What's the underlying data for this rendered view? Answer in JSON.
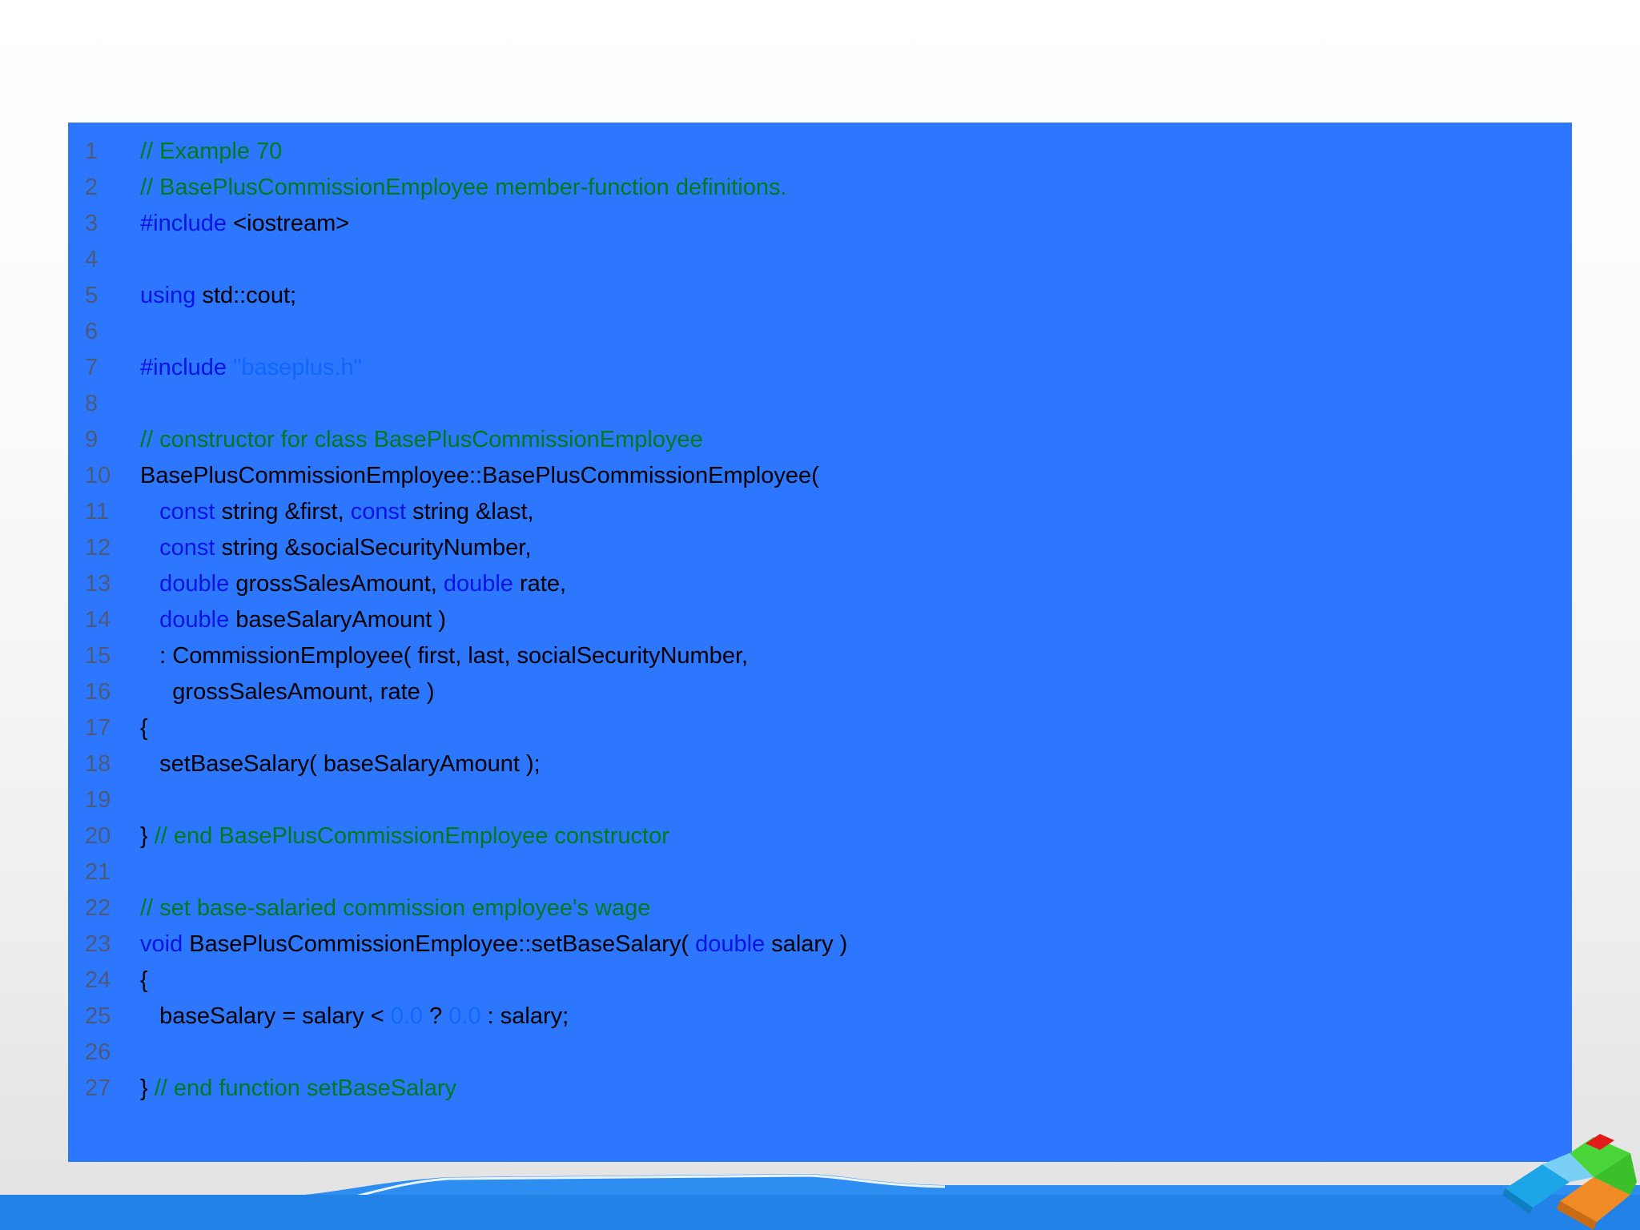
{
  "code": {
    "lines": [
      {
        "n": "1",
        "tokens": [
          {
            "t": "// Example 70",
            "k": "comment"
          }
        ]
      },
      {
        "n": "2",
        "tokens": [
          {
            "t": "// BasePlusCommissionEmployee member-function definitions.",
            "k": "comment"
          }
        ]
      },
      {
        "n": "3",
        "tokens": [
          {
            "t": "#include",
            "k": "keyword"
          },
          {
            "t": " <iostream>",
            "k": "plain"
          }
        ]
      },
      {
        "n": "4",
        "tokens": []
      },
      {
        "n": "5",
        "tokens": [
          {
            "t": "using",
            "k": "keyword"
          },
          {
            "t": " std::cout;",
            "k": "plain"
          }
        ]
      },
      {
        "n": "6",
        "tokens": []
      },
      {
        "n": "7",
        "tokens": [
          {
            "t": "#include",
            "k": "keyword"
          },
          {
            "t": " ",
            "k": "plain"
          },
          {
            "t": "\"baseplus.h\"",
            "k": "string"
          }
        ]
      },
      {
        "n": "8",
        "tokens": []
      },
      {
        "n": "9",
        "tokens": [
          {
            "t": "// constructor for class BasePlusCommissionEmployee",
            "k": "comment"
          }
        ]
      },
      {
        "n": "10",
        "tokens": [
          {
            "t": "BasePlusCommissionEmployee::BasePlusCommissionEmployee(",
            "k": "plain"
          }
        ]
      },
      {
        "n": "11",
        "tokens": [
          {
            "t": "   ",
            "k": "plain"
          },
          {
            "t": "const",
            "k": "keyword"
          },
          {
            "t": " string &first, ",
            "k": "plain"
          },
          {
            "t": "const",
            "k": "keyword"
          },
          {
            "t": " string &last,",
            "k": "plain"
          }
        ]
      },
      {
        "n": "12",
        "tokens": [
          {
            "t": "   ",
            "k": "plain"
          },
          {
            "t": "const",
            "k": "keyword"
          },
          {
            "t": " string &socialSecurityNumber,",
            "k": "plain"
          }
        ]
      },
      {
        "n": "13",
        "tokens": [
          {
            "t": "   ",
            "k": "plain"
          },
          {
            "t": "double",
            "k": "keyword"
          },
          {
            "t": " grossSalesAmount, ",
            "k": "plain"
          },
          {
            "t": "double",
            "k": "keyword"
          },
          {
            "t": " rate,",
            "k": "plain"
          }
        ]
      },
      {
        "n": "14",
        "tokens": [
          {
            "t": "   ",
            "k": "plain"
          },
          {
            "t": "double",
            "k": "keyword"
          },
          {
            "t": " baseSalaryAmount )",
            "k": "plain"
          }
        ]
      },
      {
        "n": "15",
        "tokens": [
          {
            "t": "   : CommissionEmployee( first, last, socialSecurityNumber,",
            "k": "plain"
          }
        ]
      },
      {
        "n": "16",
        "tokens": [
          {
            "t": "     grossSalesAmount, rate )",
            "k": "plain"
          }
        ]
      },
      {
        "n": "17",
        "tokens": [
          {
            "t": "{",
            "k": "plain"
          }
        ]
      },
      {
        "n": "18",
        "tokens": [
          {
            "t": "   setBaseSalary( baseSalaryAmount );",
            "k": "plain"
          }
        ]
      },
      {
        "n": "19",
        "tokens": []
      },
      {
        "n": "20",
        "tokens": [
          {
            "t": "} ",
            "k": "plain"
          },
          {
            "t": "// end BasePlusCommissionEmployee constructor",
            "k": "comment"
          }
        ]
      },
      {
        "n": "21",
        "tokens": []
      },
      {
        "n": "22",
        "tokens": [
          {
            "t": "// set base-salaried commission employee's wage",
            "k": "comment"
          }
        ]
      },
      {
        "n": "23",
        "tokens": [
          {
            "t": "void",
            "k": "keyword"
          },
          {
            "t": " BasePlusCommissionEmployee::setBaseSalary( ",
            "k": "plain"
          },
          {
            "t": "double",
            "k": "keyword"
          },
          {
            "t": " salary )",
            "k": "plain"
          }
        ]
      },
      {
        "n": "24",
        "tokens": [
          {
            "t": "{",
            "k": "plain"
          }
        ]
      },
      {
        "n": "25",
        "tokens": [
          {
            "t": "   baseSalary = salary < ",
            "k": "plain"
          },
          {
            "t": "0.0",
            "k": "number"
          },
          {
            "t": " ? ",
            "k": "plain"
          },
          {
            "t": "0.0",
            "k": "number"
          },
          {
            "t": " : salary;",
            "k": "plain"
          }
        ]
      },
      {
        "n": "26",
        "tokens": []
      },
      {
        "n": "27",
        "tokens": [
          {
            "t": "} ",
            "k": "plain"
          },
          {
            "t": "// end function setBaseSalary",
            "k": "comment"
          }
        ]
      }
    ]
  },
  "colors": {
    "panel_background": "#2c77fe",
    "comment": "#007a1e",
    "keyword": "#0b12e6",
    "string_literal": "#1166ff",
    "line_number": "#4b5a7a",
    "footer_band": "#2282e8"
  },
  "decorations": {
    "logo_icon": "cube-logo-icon"
  }
}
